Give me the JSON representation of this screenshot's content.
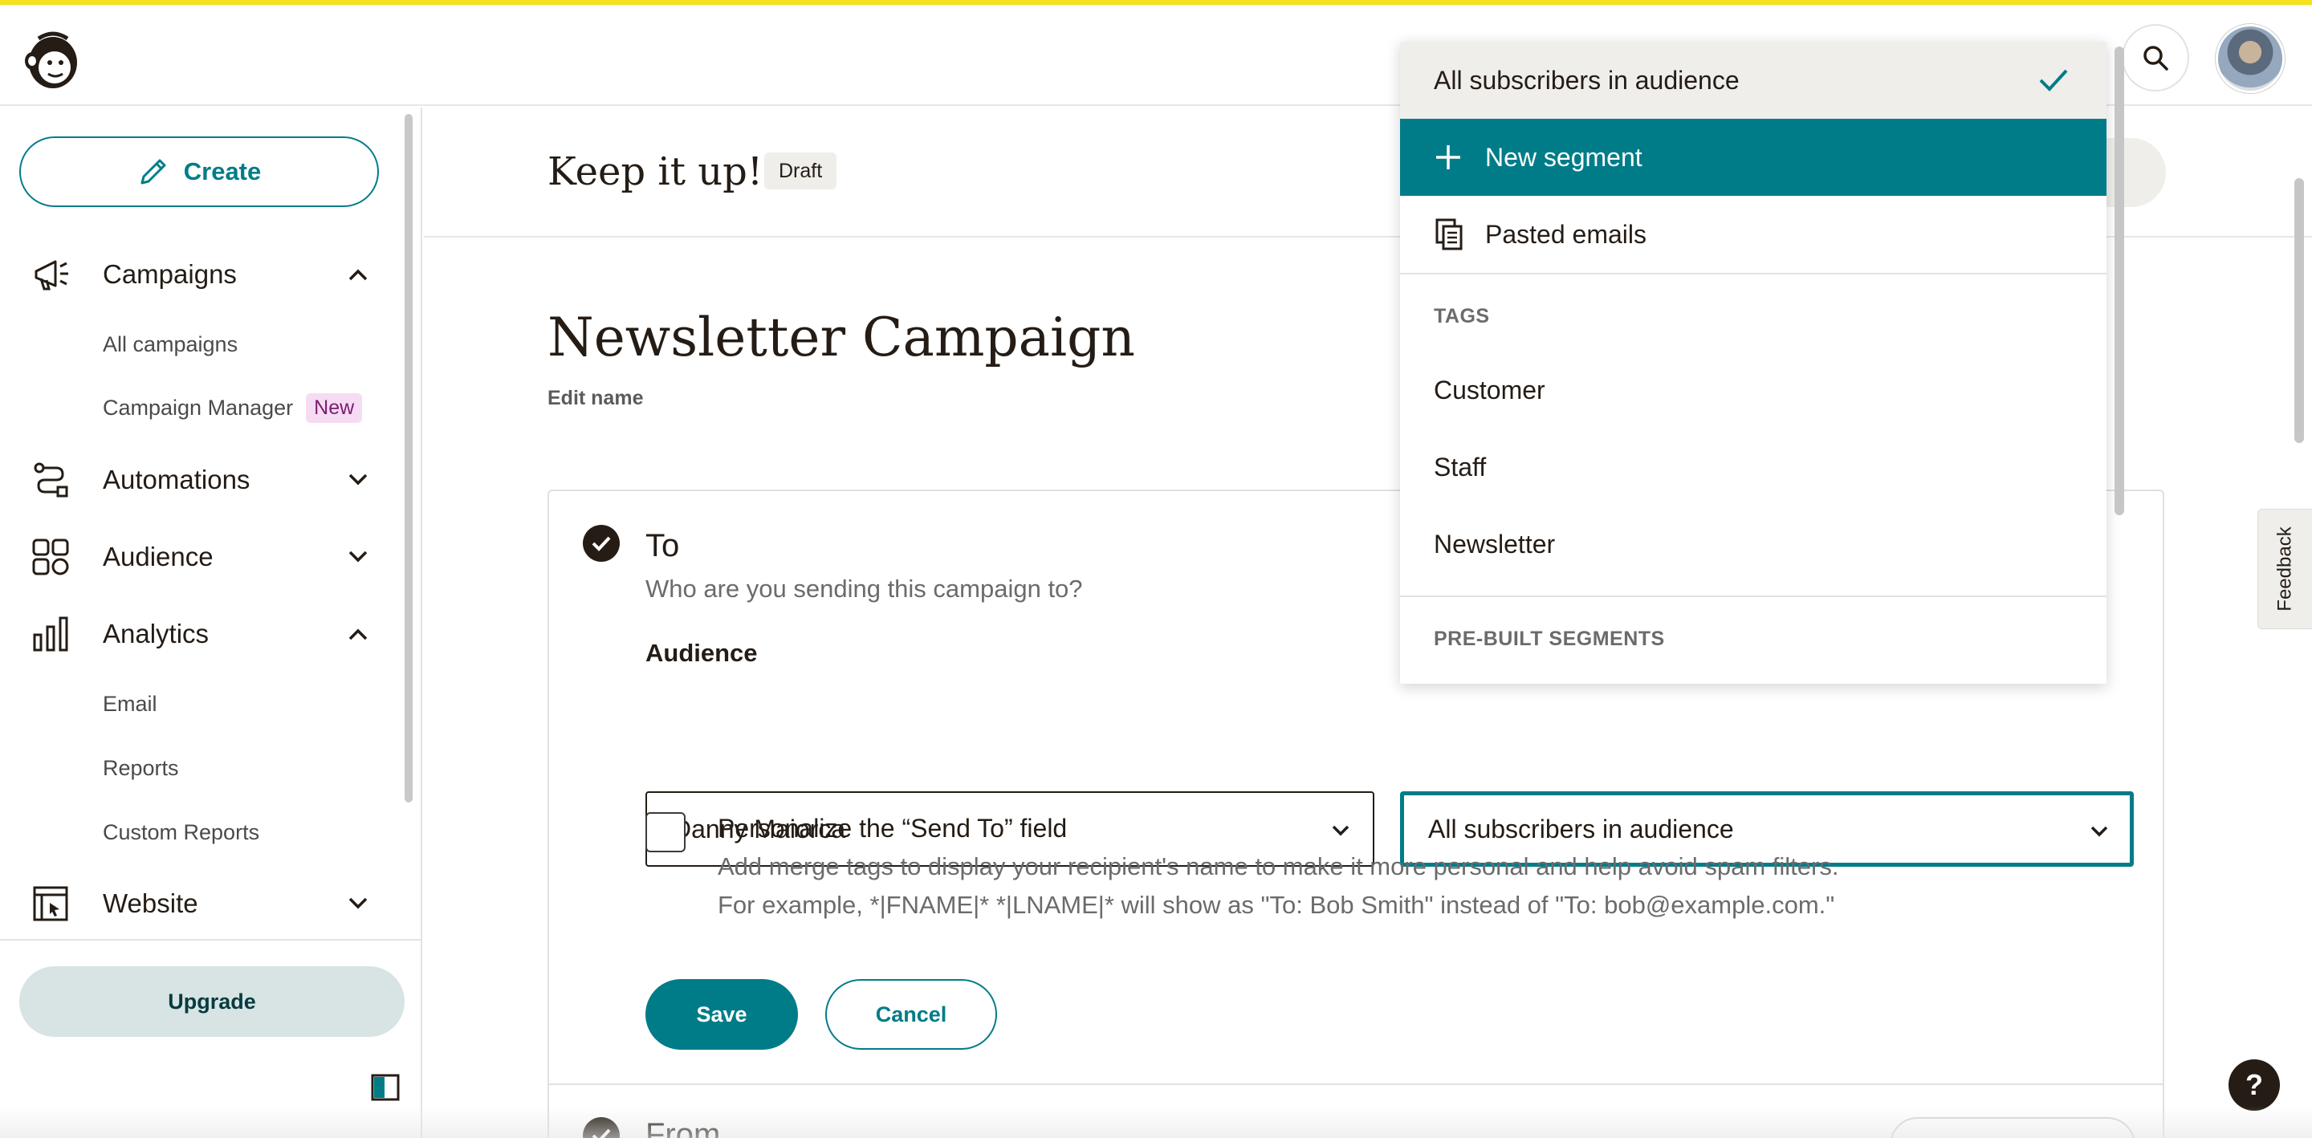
{
  "sidebar": {
    "create_label": "Create",
    "nav": [
      {
        "label": "Campaigns",
        "expanded": true,
        "icon": "megaphone-icon"
      },
      {
        "label": "Automations",
        "expanded": false,
        "icon": "automations-icon"
      },
      {
        "label": "Audience",
        "expanded": false,
        "icon": "audience-icon"
      },
      {
        "label": "Analytics",
        "expanded": true,
        "icon": "bar-chart-icon"
      },
      {
        "label": "Website",
        "expanded": false,
        "icon": "website-icon"
      }
    ],
    "campaigns_sub": [
      "All campaigns",
      "Campaign Manager"
    ],
    "campaign_manager_badge": "New",
    "analytics_sub": [
      "Email",
      "Reports",
      "Custom Reports"
    ],
    "upgrade_label": "Upgrade"
  },
  "header": {
    "title": "Keep it up!",
    "status": "Draft"
  },
  "campaign": {
    "name": "Newsletter Campaign",
    "edit_name_label": "Edit name"
  },
  "to_section": {
    "title": "To",
    "subtitle": "Who are you sending this campaign to?",
    "audience_label": "Audience",
    "audience_value": "Danny Maiorca",
    "segment_value": "All subscribers in audience",
    "personalize_title": "Personalize the “Send To” field",
    "personalize_desc_1": "Add merge tags to display your recipient's name to make it more personal and help avoid spam filters.",
    "personalize_desc_2": "For example, *|FNAME|* *|LNAME|* will show as \"To: Bob Smith\" instead of \"To: bob@example.com.\"",
    "save_label": "Save",
    "cancel_label": "Cancel"
  },
  "from_section": {
    "title": "From"
  },
  "dropdown": {
    "selected": "All subscribers in audience",
    "new_segment": "New segment",
    "pasted_emails": "Pasted emails",
    "tags_heading": "TAGS",
    "tags": [
      "Customer",
      "Staff",
      "Newsletter"
    ],
    "prebuilt_heading": "PRE-BUILT SEGMENTS"
  },
  "feedback_label": "Feedback",
  "help_label": "?",
  "colors": {
    "brand_teal": "#007c89",
    "top_stripe": "#f5e11c",
    "text_dark": "#241c15"
  }
}
